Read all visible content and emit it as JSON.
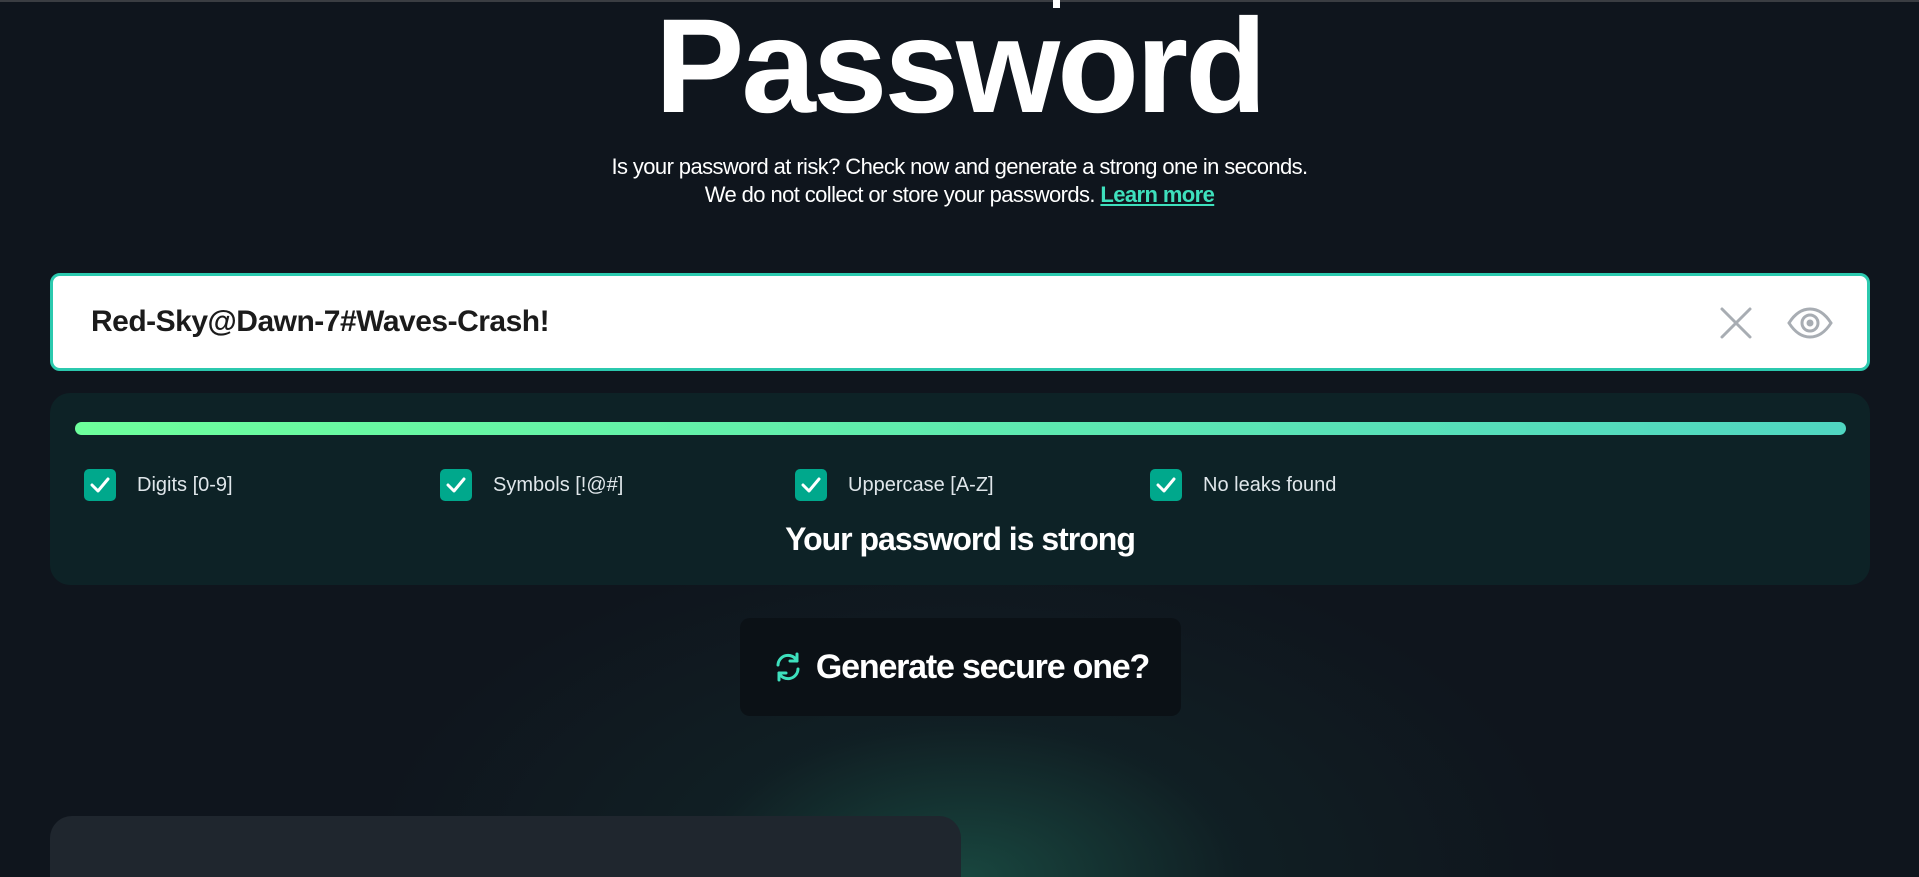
{
  "header": {
    "title": "Password",
    "subtitle_line1": "Is your password at risk? Check now and generate a strong one in seconds.",
    "subtitle_line2": "We do not collect or store your passwords.",
    "learn_more": "Learn more"
  },
  "password_input": {
    "value": "Red-Sky@Dawn-7#Waves-Crash!",
    "clear_icon": "close-icon",
    "visibility_icon": "eye-icon"
  },
  "strength": {
    "progress_percent": 100,
    "checks": [
      {
        "label": "Digits [0-9]",
        "checked": true
      },
      {
        "label": "Symbols [!@#]",
        "checked": true
      },
      {
        "label": "Uppercase [A-Z]",
        "checked": true
      },
      {
        "label": "No leaks found",
        "checked": true
      }
    ],
    "message": "Your password is strong"
  },
  "generate_button": {
    "label": "Generate secure one?",
    "icon": "refresh-icon"
  },
  "colors": {
    "accent": "#2bc9ae",
    "checkbox": "#00a88c",
    "background": "#0f151d",
    "panel": "#0d2226"
  }
}
